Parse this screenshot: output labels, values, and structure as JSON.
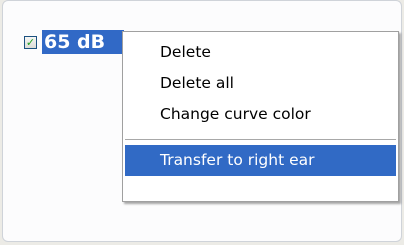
{
  "item": {
    "checked": true,
    "label": "65 dB"
  },
  "menu": {
    "items": [
      {
        "label": "Delete",
        "selected": false
      },
      {
        "label": "Delete all",
        "selected": false
      },
      {
        "label": "Change curve color",
        "selected": false
      },
      {
        "label": "Transfer to right ear",
        "selected": true
      }
    ]
  },
  "colors": {
    "selection": "#316ac5",
    "check": "#21a121",
    "panel_background": "#fcfcfd"
  },
  "icons": {
    "checkbox": "checkmark-icon"
  }
}
